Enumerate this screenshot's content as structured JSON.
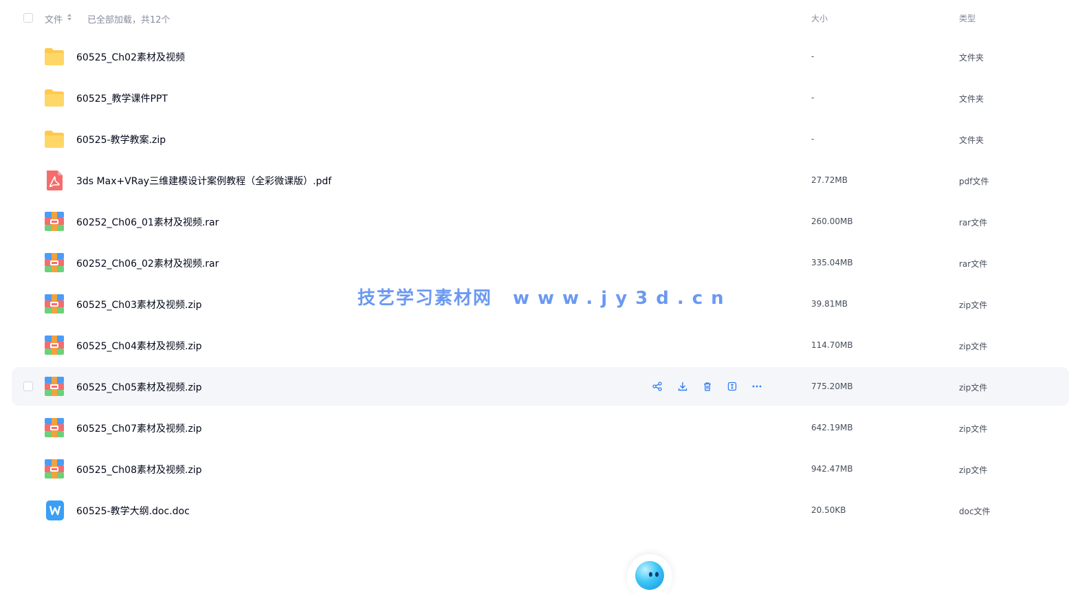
{
  "header": {
    "file_label": "文件",
    "status": "已全部加载，共12个",
    "size_label": "大小",
    "type_label": "类型"
  },
  "rows": [
    {
      "name": "60525_Ch02素材及视频",
      "size": "-",
      "type": "文件夹",
      "icon": "folder-icon"
    },
    {
      "name": "60525_教学课件PPT",
      "size": "-",
      "type": "文件夹",
      "icon": "folder-icon"
    },
    {
      "name": "60525-教学教案.zip",
      "size": "-",
      "type": "文件夹",
      "icon": "folder-icon"
    },
    {
      "name": "3ds Max+VRay三维建模设计案例教程（全彩微课版）.pdf",
      "size": "27.72MB",
      "type": "pdf文件",
      "icon": "pdf-icon"
    },
    {
      "name": "60252_Ch06_01素材及视频.rar",
      "size": "260.00MB",
      "type": "rar文件",
      "icon": "archive-icon"
    },
    {
      "name": "60252_Ch06_02素材及视频.rar",
      "size": "335.04MB",
      "type": "rar文件",
      "icon": "archive-icon"
    },
    {
      "name": "60525_Ch03素材及视频.zip",
      "size": "39.81MB",
      "type": "zip文件",
      "icon": "archive-icon"
    },
    {
      "name": "60525_Ch04素材及视频.zip",
      "size": "114.70MB",
      "type": "zip文件",
      "icon": "archive-icon"
    },
    {
      "name": "60525_Ch05素材及视频.zip",
      "size": "775.20MB",
      "type": "zip文件",
      "icon": "archive-icon",
      "hovered": true
    },
    {
      "name": "60525_Ch07素材及视频.zip",
      "size": "642.19MB",
      "type": "zip文件",
      "icon": "archive-icon"
    },
    {
      "name": "60525_Ch08素材及视频.zip",
      "size": "942.47MB",
      "type": "zip文件",
      "icon": "archive-icon"
    },
    {
      "name": "60525-教学大纲.doc.doc",
      "size": "20.50KB",
      "type": "doc文件",
      "icon": "doc-icon"
    }
  ],
  "row_actions": [
    "share-icon",
    "download-icon",
    "delete-icon",
    "rename-icon",
    "more-icon"
  ],
  "watermark": {
    "site": "技艺学习素材网",
    "url": "www.jy3d.cn"
  },
  "colors": {
    "accent": "#2f7cf0",
    "hover_row": "#f5f6f9",
    "muted_text": "#878c9c",
    "folder": "#ffc94d",
    "pdf": "#f46d6d",
    "doc": "#3a9ff5"
  }
}
